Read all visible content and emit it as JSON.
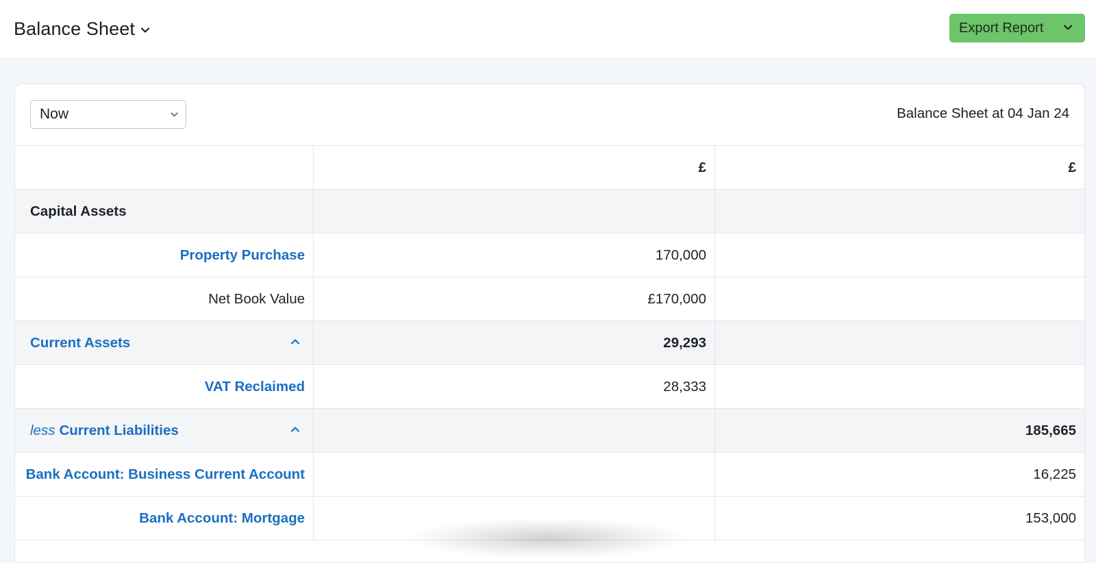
{
  "header": {
    "title": "Balance Sheet",
    "export_label": "Export Report"
  },
  "controls": {
    "period": "Now",
    "as_at": "Balance Sheet at 04 Jan 24"
  },
  "table": {
    "currency_headers": [
      "£",
      "£"
    ],
    "rows": [
      {
        "label": "Capital Assets",
        "col1": "",
        "col2": ""
      },
      {
        "label": "Property Purchase",
        "col1": "170,000",
        "col2": ""
      },
      {
        "label": "Net Book Value",
        "col1": "£170,000",
        "col2": ""
      },
      {
        "label": "Current Assets",
        "col1": "29,293",
        "col2": ""
      },
      {
        "label": "VAT Reclaimed",
        "col1": "28,333",
        "col2": ""
      },
      {
        "label_prefix": "less",
        "label": "Current Liabilities",
        "col1": "",
        "col2": "185,665"
      },
      {
        "label": "Bank Account: Business Current Account",
        "col1": "",
        "col2": "16,225"
      },
      {
        "label": "Bank Account: Mortgage",
        "col1": "",
        "col2": "153,000"
      }
    ]
  },
  "colors": {
    "link": "#1a6fc2",
    "accent_button": "#6cc56a",
    "group_row": "#f4f5f7"
  },
  "icons": {
    "title_dropdown": "chevron-down-icon",
    "export_dropdown": "chevron-down-icon",
    "select_dropdown": "chevron-down-icon",
    "collapse": "chevron-up-icon"
  }
}
